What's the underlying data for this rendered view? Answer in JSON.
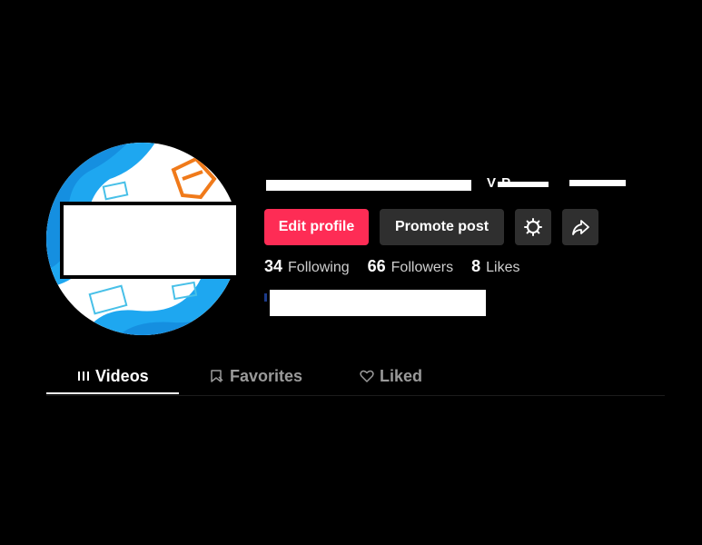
{
  "profile": {
    "name_fragment": "V       P",
    "avatar_alt": ""
  },
  "actions": {
    "edit_profile": "Edit profile",
    "promote_post": "Promote post"
  },
  "stats": [
    {
      "value": "34",
      "label": "Following"
    },
    {
      "value": "66",
      "label": "Followers"
    },
    {
      "value": "8",
      "label": "Likes"
    }
  ],
  "tabs": [
    {
      "label": "Videos",
      "active": true
    },
    {
      "label": "Favorites",
      "active": false
    },
    {
      "label": "Liked",
      "active": false
    }
  ],
  "colors": {
    "background": "#000000",
    "accent": "#fe2c55",
    "secondary_button": "#2f2f2f"
  }
}
